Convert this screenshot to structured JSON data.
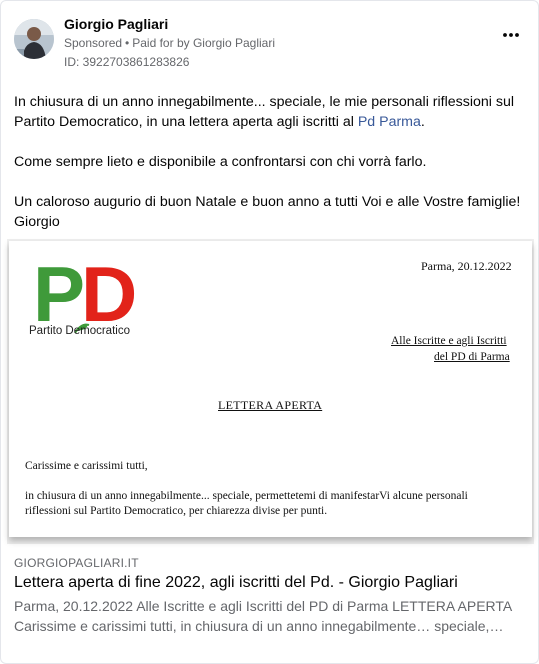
{
  "post": {
    "author": "Giorgio Pagliari",
    "sponsored": "Sponsored",
    "paid_for": "Paid for by Giorgio Pagliari",
    "ad_id": "ID: 3922703861283826",
    "more_icon": "more-options-icon",
    "text": {
      "para1_before": "In chiusura di un anno innegabilmente... speciale, le mie personali riflessioni sul Partito Democratico, in una lettera aperta agli iscritti al ",
      "para1_link": "Pd Parma",
      "para1_after": ".",
      "para2": "Come sempre lieto e disponibile a confrontarsi con chi vorrà farlo.",
      "para3_line1": "Un caloroso augurio di buon Natale e buon anno a tutti Voi e alle Vostre famiglie!",
      "para3_line2": "Giorgio"
    }
  },
  "letter_image": {
    "logo_letters": "PD",
    "logo_text": "Partito Democratico",
    "date": "Parma, 20.12.2022",
    "address_line1": "Alle Iscritte e agli Iscritti",
    "address_line2": "del PD di Parma",
    "title": "LETTERA APERTA",
    "greeting": "Carissime e carissimi tutti,",
    "line1": "in chiusura di un anno innegabilmente... speciale,  permettetemi di manifestarVi alcune personali",
    "line2": "riflessioni sul Partito Democratico, per chiarezza divise per punti."
  },
  "link_preview": {
    "domain": "GIORGIOPAGLIARI.IT",
    "title": "Lettera aperta di fine 2022, agli iscritti del Pd. - Giorgio Pagliari",
    "description": "Parma, 20.12.2022 Alle Iscritte e agli Iscritti del PD di Parma LETTERA APERTA Carissime e carissimi tutti, in chiusura di un anno innegabilmente… speciale,…"
  },
  "colors": {
    "link": "#385898",
    "secondary_text": "#65676b",
    "pd_green": "#3f9a3a",
    "pd_red": "#e2231a"
  }
}
